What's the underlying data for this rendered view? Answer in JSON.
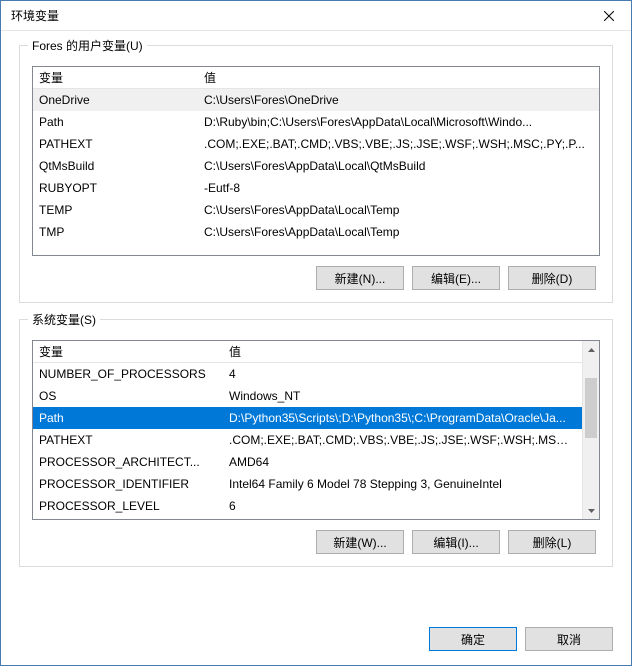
{
  "dialog": {
    "title": "环境变量"
  },
  "user_group": {
    "label": "Fores 的用户变量(U)",
    "header_var": "变量",
    "header_val": "值",
    "rows": [
      {
        "var": "OneDrive",
        "val": "C:\\Users\\Fores\\OneDrive"
      },
      {
        "var": "Path",
        "val": "D:\\Ruby\\bin;C:\\Users\\Fores\\AppData\\Local\\Microsoft\\Windo..."
      },
      {
        "var": "PATHEXT",
        "val": ".COM;.EXE;.BAT;.CMD;.VBS;.VBE;.JS;.JSE;.WSF;.WSH;.MSC;.PY;.P..."
      },
      {
        "var": "QtMsBuild",
        "val": "C:\\Users\\Fores\\AppData\\Local\\QtMsBuild"
      },
      {
        "var": "RUBYOPT",
        "val": "-Eutf-8"
      },
      {
        "var": "TEMP",
        "val": "C:\\Users\\Fores\\AppData\\Local\\Temp"
      },
      {
        "var": "TMP",
        "val": "C:\\Users\\Fores\\AppData\\Local\\Temp"
      }
    ],
    "selected_index": 0,
    "buttons": {
      "new": "新建(N)...",
      "edit": "编辑(E)...",
      "delete": "删除(D)"
    }
  },
  "sys_group": {
    "label": "系统变量(S)",
    "header_var": "变量",
    "header_val": "值",
    "rows": [
      {
        "var": "NUMBER_OF_PROCESSORS",
        "val": "4"
      },
      {
        "var": "OS",
        "val": "Windows_NT"
      },
      {
        "var": "Path",
        "val": "D:\\Python35\\Scripts\\;D:\\Python35\\;C:\\ProgramData\\Oracle\\Ja..."
      },
      {
        "var": "PATHEXT",
        "val": ".COM;.EXE;.BAT;.CMD;.VBS;.VBE;.JS;.JSE;.WSF;.WSH;.MSC;.PY;.P..."
      },
      {
        "var": "PROCESSOR_ARCHITECT...",
        "val": "AMD64"
      },
      {
        "var": "PROCESSOR_IDENTIFIER",
        "val": "Intel64 Family 6 Model 78 Stepping 3, GenuineIntel"
      },
      {
        "var": "PROCESSOR_LEVEL",
        "val": "6"
      }
    ],
    "selected_index": 2,
    "buttons": {
      "new": "新建(W)...",
      "edit": "编辑(I)...",
      "delete": "删除(L)"
    }
  },
  "footer": {
    "ok": "确定",
    "cancel": "取消"
  }
}
